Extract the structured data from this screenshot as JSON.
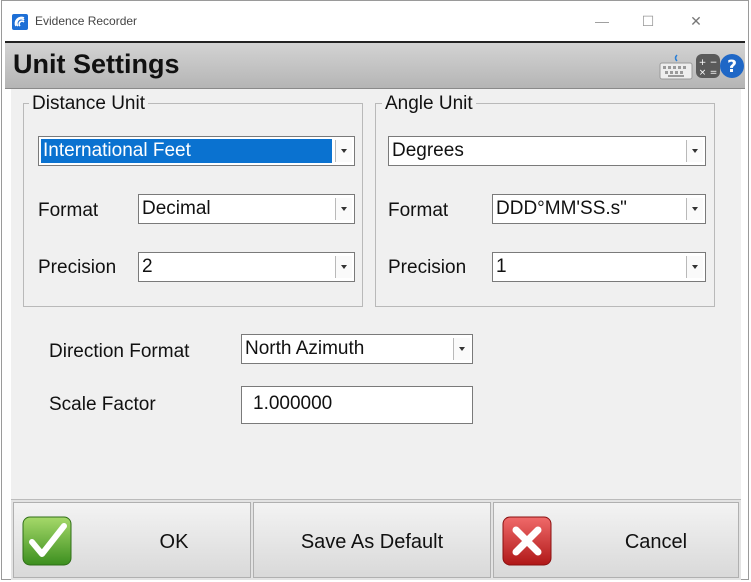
{
  "window": {
    "title": "Evidence Recorder",
    "minimize": "—",
    "maximize": "☐",
    "close": "✕"
  },
  "header": {
    "title": "Unit Settings"
  },
  "distance": {
    "group_label": "Distance Unit",
    "unit_value": "International Feet",
    "format_label": "Format",
    "format_value": "Decimal",
    "precision_label": "Precision",
    "precision_value": "2"
  },
  "angle": {
    "group_label": "Angle Unit",
    "unit_value": "Degrees",
    "format_label": "Format",
    "format_value": "DDD°MM'SS.s\"",
    "precision_label": "Precision",
    "precision_value": "1"
  },
  "direction": {
    "label": "Direction Format",
    "value": "North Azimuth"
  },
  "scale": {
    "label": "Scale Factor",
    "value": "1.000000"
  },
  "buttons": {
    "ok": "OK",
    "save_default": "Save As Default",
    "cancel": "Cancel"
  }
}
